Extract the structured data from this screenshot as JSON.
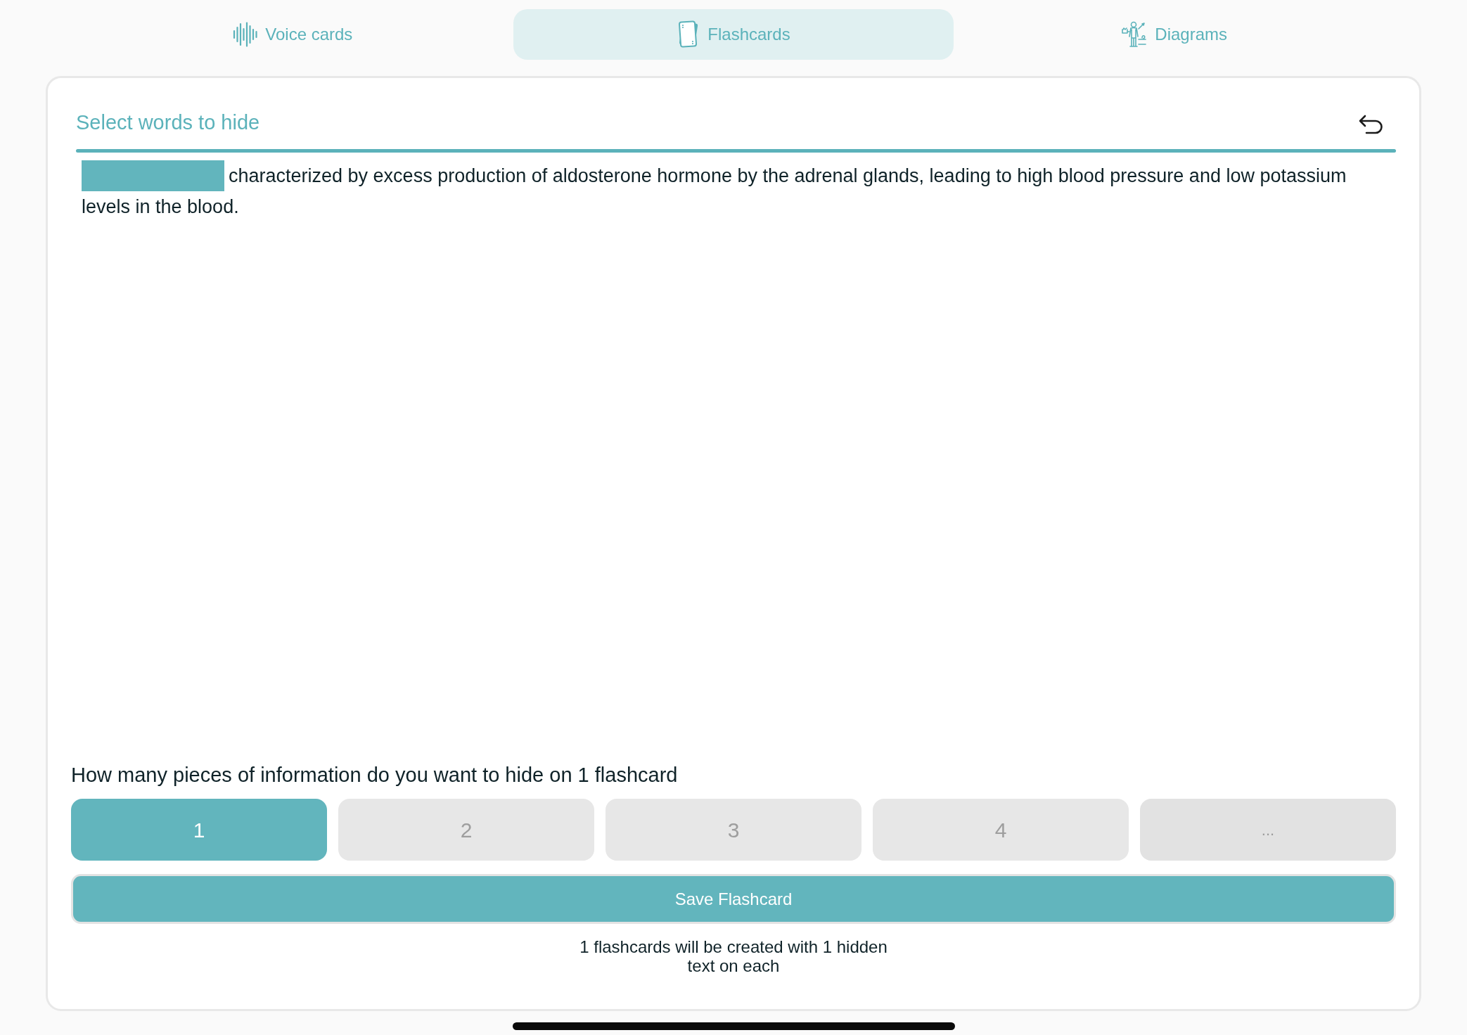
{
  "tabs": [
    {
      "label": "Voice cards",
      "kind": "waveform",
      "selected": false
    },
    {
      "label": "Flashcards",
      "kind": "cards",
      "selected": true
    },
    {
      "label": "Diagrams",
      "kind": "figure",
      "selected": false
    }
  ],
  "editor": {
    "title": "Select words to hide",
    "lines": [
      [
        {
          "kind": "mask"
        },
        {
          "kind": "text",
          "text": "characterized by excess production of aldosterone hormone by the adrenal glands, leading to high blood pressure and low potassium"
        }
      ],
      [
        {
          "kind": "text",
          "text": "levels in the blood."
        }
      ]
    ]
  },
  "question": "How many pieces of information do you want to hide on 1 flashcard",
  "options": [
    {
      "label": "1",
      "kind": "count",
      "selected": true
    },
    {
      "label": "2",
      "kind": "count",
      "selected": false
    },
    {
      "label": "3",
      "kind": "count",
      "selected": false
    },
    {
      "label": "4",
      "kind": "count",
      "selected": false
    },
    {
      "label": "...",
      "kind": "more",
      "selected": false
    }
  ],
  "save_button": "Save Flashcard",
  "summary": "1 flashcards will be created with 1 hidden text on each"
}
